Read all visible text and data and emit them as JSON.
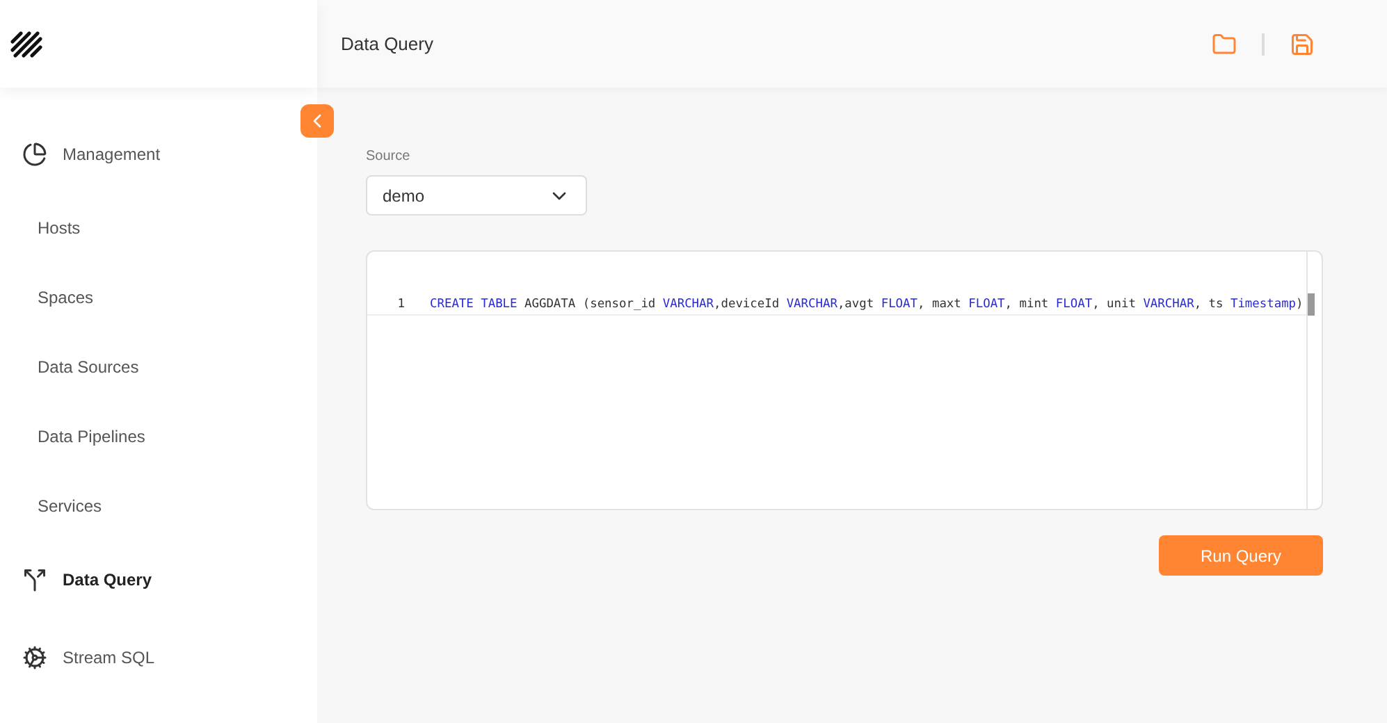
{
  "header": {
    "title": "Data Query"
  },
  "sidebar": {
    "items": [
      {
        "label": "Management",
        "kind": "pie",
        "selected": false
      },
      {
        "label": "Hosts",
        "kind": "sub",
        "selected": false
      },
      {
        "label": "Spaces",
        "kind": "sub",
        "selected": false
      },
      {
        "label": "Data Sources",
        "kind": "sub",
        "selected": false
      },
      {
        "label": "Data Pipelines",
        "kind": "sub",
        "selected": false
      },
      {
        "label": "Services",
        "kind": "sub",
        "selected": false
      },
      {
        "label": "Data Query",
        "kind": "split",
        "selected": true
      },
      {
        "label": "Stream SQL",
        "kind": "gears",
        "selected": false
      }
    ]
  },
  "source": {
    "label": "Source",
    "value": "demo"
  },
  "editor": {
    "lines": [
      {
        "number": "1",
        "tokens": [
          {
            "text": "CREATE",
            "kind": "keyword"
          },
          {
            "text": " TABLE",
            "kind": "keyword"
          },
          {
            "text": " AGGDATA (sensor_id ",
            "kind": "text"
          },
          {
            "text": "VARCHAR",
            "kind": "keyword"
          },
          {
            "text": ",deviceId ",
            "kind": "text"
          },
          {
            "text": "VARCHAR",
            "kind": "keyword"
          },
          {
            "text": ",avgt ",
            "kind": "text"
          },
          {
            "text": "FLOAT",
            "kind": "keyword"
          },
          {
            "text": ", maxt ",
            "kind": "text"
          },
          {
            "text": "FLOAT",
            "kind": "keyword"
          },
          {
            "text": ", mint ",
            "kind": "text"
          },
          {
            "text": "FLOAT",
            "kind": "keyword"
          },
          {
            "text": ", unit ",
            "kind": "text"
          },
          {
            "text": "VARCHAR",
            "kind": "keyword"
          },
          {
            "text": ", ts ",
            "kind": "text"
          },
          {
            "text": "Timestamp",
            "kind": "keyword"
          },
          {
            "text": ")",
            "kind": "text"
          }
        ]
      }
    ]
  },
  "run_button": "Run Query"
}
